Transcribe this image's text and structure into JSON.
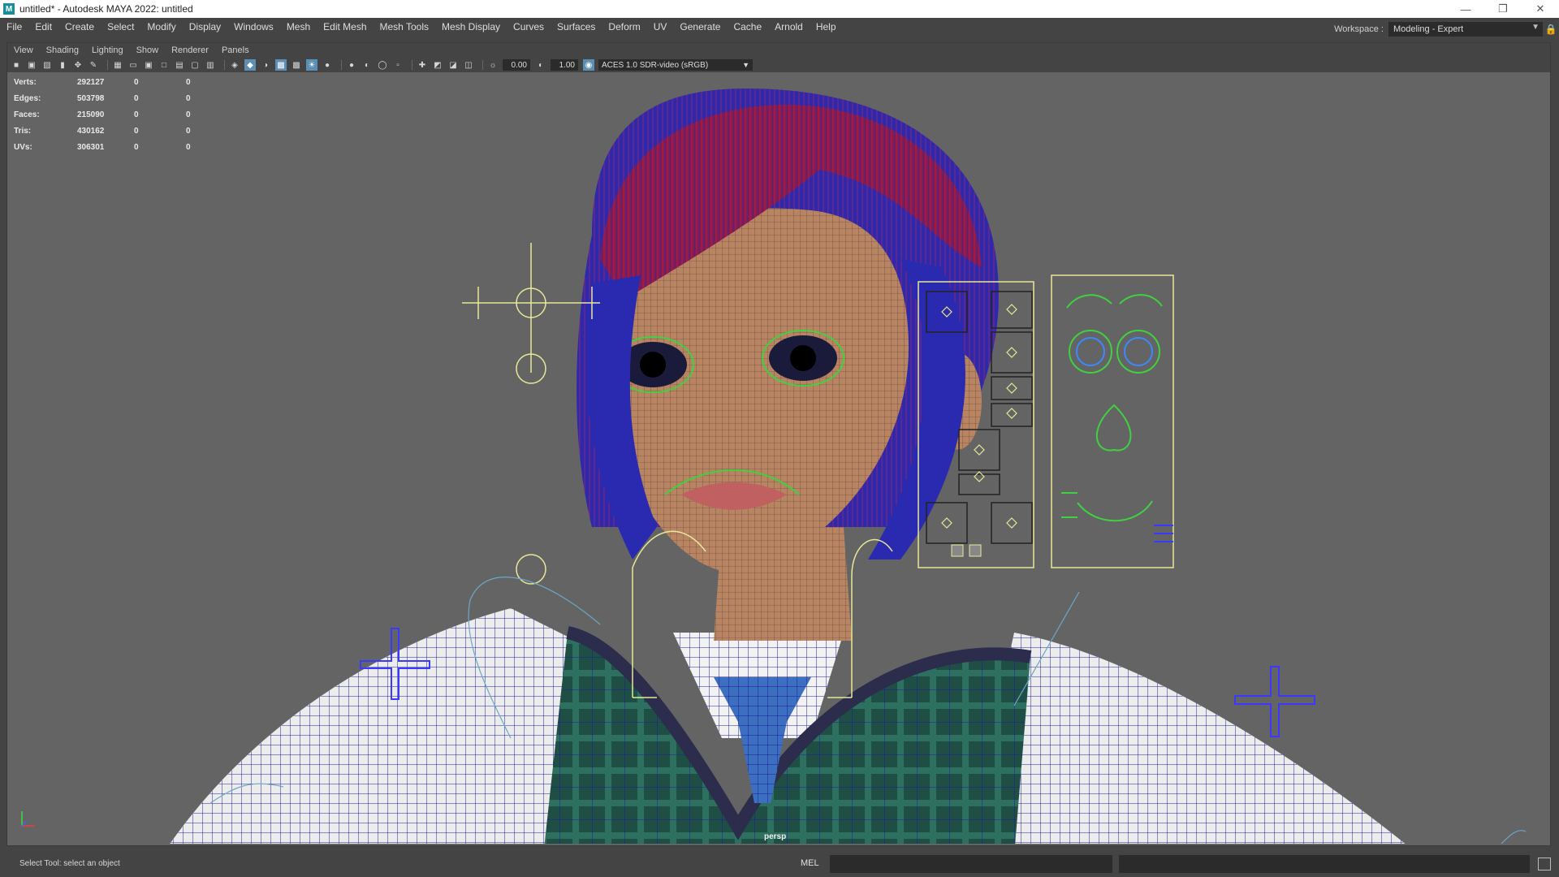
{
  "window": {
    "title": "untitled* - Autodesk MAYA 2022: untitled",
    "logo": "M",
    "controls": [
      "minimize-icon",
      "restore-icon",
      "close-icon"
    ]
  },
  "menubar": {
    "items": [
      "File",
      "Edit",
      "Create",
      "Select",
      "Modify",
      "Display",
      "Windows",
      "Mesh",
      "Edit Mesh",
      "Mesh Tools",
      "Mesh Display",
      "Curves",
      "Surfaces",
      "Deform",
      "UV",
      "Generate",
      "Cache",
      "Arnold",
      "Help"
    ]
  },
  "workspace": {
    "label": "Workspace :",
    "value": "Modeling - Expert"
  },
  "panel": {
    "menu": [
      "View",
      "Shading",
      "Lighting",
      "Show",
      "Renderer",
      "Panels"
    ],
    "near_clip": "0.00",
    "far_clip": "1.00",
    "color_space": "ACES 1.0 SDR-video (sRGB)",
    "camera": "persp"
  },
  "hud": {
    "rows": [
      {
        "label": "Verts:",
        "value": "292127",
        "sel": "0",
        "comp": "0"
      },
      {
        "label": "Edges:",
        "value": "503798",
        "sel": "0",
        "comp": "0"
      },
      {
        "label": "Faces:",
        "value": "215090",
        "sel": "0",
        "comp": "0"
      },
      {
        "label": "Tris:",
        "value": "430162",
        "sel": "0",
        "comp": "0"
      },
      {
        "label": "UVs:",
        "value": "306301",
        "sel": "0",
        "comp": "0"
      }
    ]
  },
  "status": {
    "help_line": "Select Tool: select an object",
    "command_language": "MEL"
  },
  "colors": {
    "viewport_bg": "#646464",
    "ui_bg": "#444444",
    "wire": "#1e1e9c",
    "hair": "#9a1e5a",
    "skin": "#b88462",
    "vest": "#2a5a4a",
    "tie": "#3d6fc0",
    "control_yellow": "#e8e89a",
    "control_green": "#40d040",
    "control_blue": "#3a3aff"
  }
}
